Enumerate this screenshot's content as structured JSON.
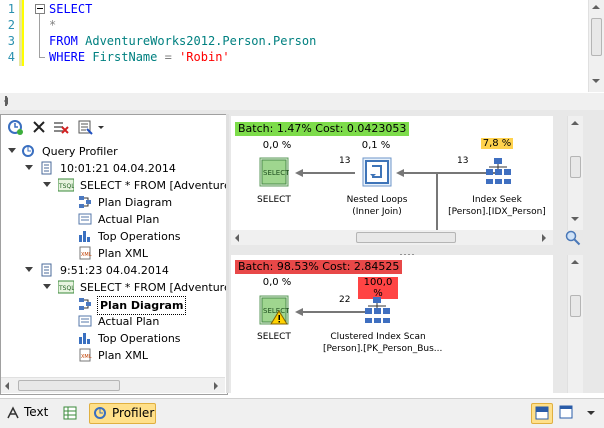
{
  "editor": {
    "lines": [
      {
        "num": "1",
        "parts": [
          {
            "t": "SELECT",
            "c": "kw"
          }
        ]
      },
      {
        "num": "2",
        "parts": [
          {
            "t": "*",
            "c": "op"
          }
        ]
      },
      {
        "num": "3",
        "parts": [
          {
            "t": "FROM ",
            "c": "kw"
          },
          {
            "t": "AdventureWorks2012.Person.Person",
            "c": "obj"
          }
        ]
      },
      {
        "num": "4",
        "parts": [
          {
            "t": "WHERE ",
            "c": "kw"
          },
          {
            "t": "FirstName",
            "c": "obj"
          },
          {
            "t": " = ",
            "c": "op"
          },
          {
            "t": "'Robin'",
            "c": "str"
          }
        ]
      }
    ]
  },
  "tree": {
    "root": "Query Profiler",
    "sessions": [
      {
        "time": "10:01:21 04.04.2014",
        "query": "SELECT * FROM [AdventureW",
        "items": [
          "Plan Diagram",
          "Actual Plan",
          "Top Operations",
          "Plan XML"
        ]
      },
      {
        "time": "9:51:23 04.04.2014",
        "query": "SELECT * FROM [AdventureW",
        "items": [
          "Plan Diagram",
          "Actual Plan",
          "Top Operations",
          "Plan XML"
        ]
      }
    ]
  },
  "plans": {
    "top": {
      "batch": "Batch: 1.47% Cost: 0.0423053",
      "batch_color": "#7ddc4a",
      "ops": [
        {
          "pct": "0,0 %",
          "icon_text": "SELECT",
          "label1": "SELECT",
          "label2": ""
        },
        {
          "pct": "0,1 %",
          "icon_text": "",
          "label1": "Nested Loops",
          "label2": "(Inner Join)"
        },
        {
          "pct": "7,8 %",
          "icon_text": "",
          "label1": "Index Seek",
          "label2": "[Person].[IDX_Person]"
        }
      ],
      "rows": [
        "13",
        "13"
      ]
    },
    "bottom": {
      "batch": "Batch: 98.53% Cost: 2.84525",
      "batch_color": "#e84848",
      "ops": [
        {
          "pct": "0,0 %",
          "icon_text": "SELECT",
          "label1": "SELECT",
          "label2": ""
        },
        {
          "pct": "100,0 %",
          "icon_text": "",
          "label1": "Clustered Index Scan",
          "label2": "[Person].[PK_Person_Bus..."
        }
      ],
      "rows": [
        "22"
      ]
    }
  },
  "statusbar": {
    "text_label": "Text",
    "profiler_label": "Profiler"
  },
  "colors": {
    "accent_selected": "#ffe08a",
    "batch_green": "#7ddc4a",
    "batch_red": "#e84848",
    "cost_highlight_yellow": "#ffd24d",
    "cost_highlight_red": "#ff4444"
  }
}
